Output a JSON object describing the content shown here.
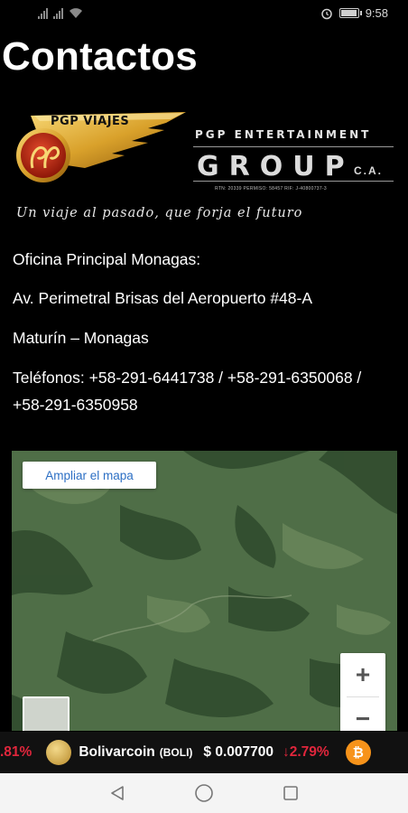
{
  "status_bar": {
    "time": "9:58"
  },
  "page": {
    "title": "Contactos"
  },
  "logo": {
    "badge": "PGP VIAJES",
    "sub": "PGP ENTERTAINMENT",
    "main": "GROUP",
    "suffix": "C.A.",
    "registration": "RTN: 20339 PERMISO: 58457 RIF: J-40800737-3",
    "slogan": "Un viaje al pasado, que forja el futuro"
  },
  "contact": {
    "office": "Oficina Principal Monagas:",
    "address": "Av. Perimetral Brisas del Aeropuerto #48-A",
    "city": "Maturín – Monagas",
    "phones": "Teléfonos: +58-291-6441738 / +58-291-6350068 / +58-291-6350958"
  },
  "map": {
    "enlarge_label": "Ampliar el mapa",
    "zoom_in": "+",
    "zoom_out": "−"
  },
  "ticker": {
    "prev_change": ".81%",
    "coin_name": "Bolivarcoin",
    "coin_symbol": "(BOLI)",
    "price": "$ 0.007700",
    "change": "↓2.79%",
    "colors": {
      "negative": "#e0263c",
      "bg": "#111111"
    }
  },
  "navbar": {
    "back_icon": "back-triangle-icon",
    "home_icon": "home-circle-icon",
    "recent_icon": "recents-square-icon"
  }
}
